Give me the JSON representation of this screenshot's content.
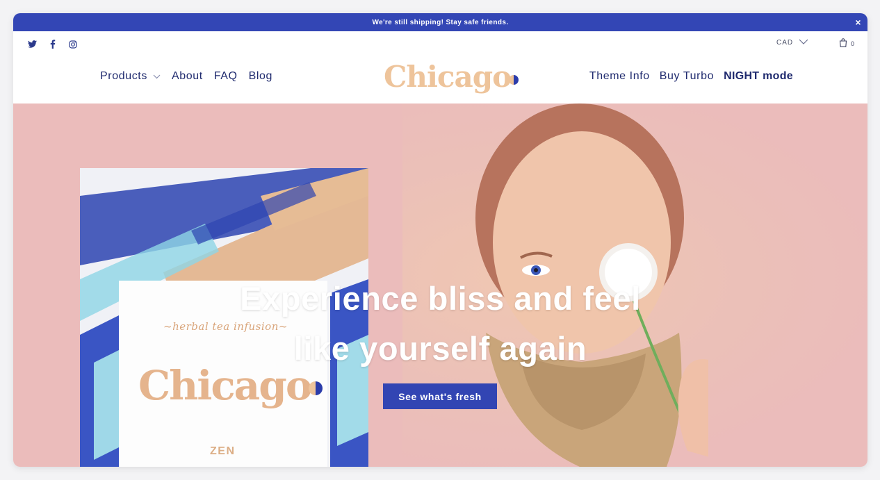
{
  "announcement": {
    "text": "We're still shipping! Stay safe friends.",
    "close": "×"
  },
  "social": {
    "items": [
      "twitter-icon",
      "facebook-icon",
      "instagram-icon"
    ]
  },
  "currency": {
    "value": "CAD"
  },
  "cart": {
    "count": "0"
  },
  "nav": {
    "left": [
      "Products",
      "About",
      "FAQ",
      "Blog"
    ],
    "right": [
      "Theme Info",
      "Buy Turbo",
      "NIGHT mode"
    ]
  },
  "logo": {
    "text": "Chicago"
  },
  "hero": {
    "headline_line1": "Experience bliss and feel",
    "headline_line2": "like yourself again",
    "cta": "See what's fresh"
  },
  "product": {
    "subtitle": "~herbal tea infusion~",
    "brand": "Chicago",
    "variant": "ZEN"
  },
  "colors": {
    "accent": "#3346b5",
    "hero_bg": "#ebbcbb",
    "logo": "#eec49b"
  }
}
